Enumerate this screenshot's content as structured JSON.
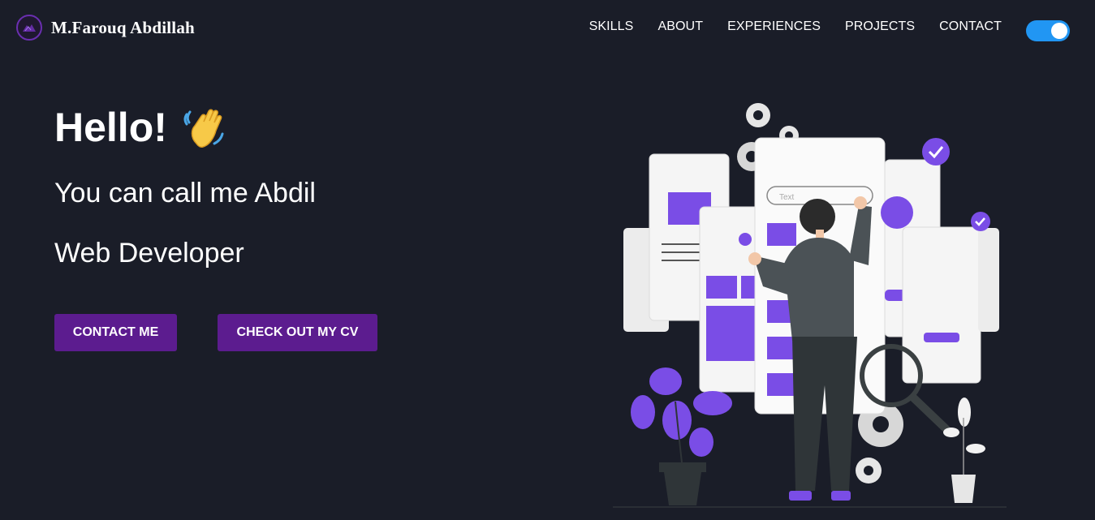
{
  "navbar": {
    "brand_name": "M.Farouq Abdillah",
    "logo_icon": "mountain-logo-icon",
    "links": [
      {
        "label": "SKILLS"
      },
      {
        "label": "ABOUT"
      },
      {
        "label": "EXPERIENCES"
      },
      {
        "label": "PROJECTS"
      },
      {
        "label": "CONTACT"
      }
    ],
    "theme_toggle": {
      "state": "on",
      "color": "#2196f3"
    }
  },
  "hero": {
    "greeting": "Hello!",
    "greeting_icon": "waving-hand-emoji",
    "intro": "You can call me Abdil",
    "role": "Web Developer",
    "buttons": {
      "contact": "CONTACT ME",
      "cv": "CHECK OUT MY CV"
    }
  },
  "illustration": {
    "name": "developer-with-mobile-screens-illustration",
    "search_placeholder": "Text"
  },
  "colors": {
    "background": "#1a1d28",
    "button": "#5c1c8f",
    "accent_purple": "#7a4de6",
    "text": "#ffffff"
  }
}
